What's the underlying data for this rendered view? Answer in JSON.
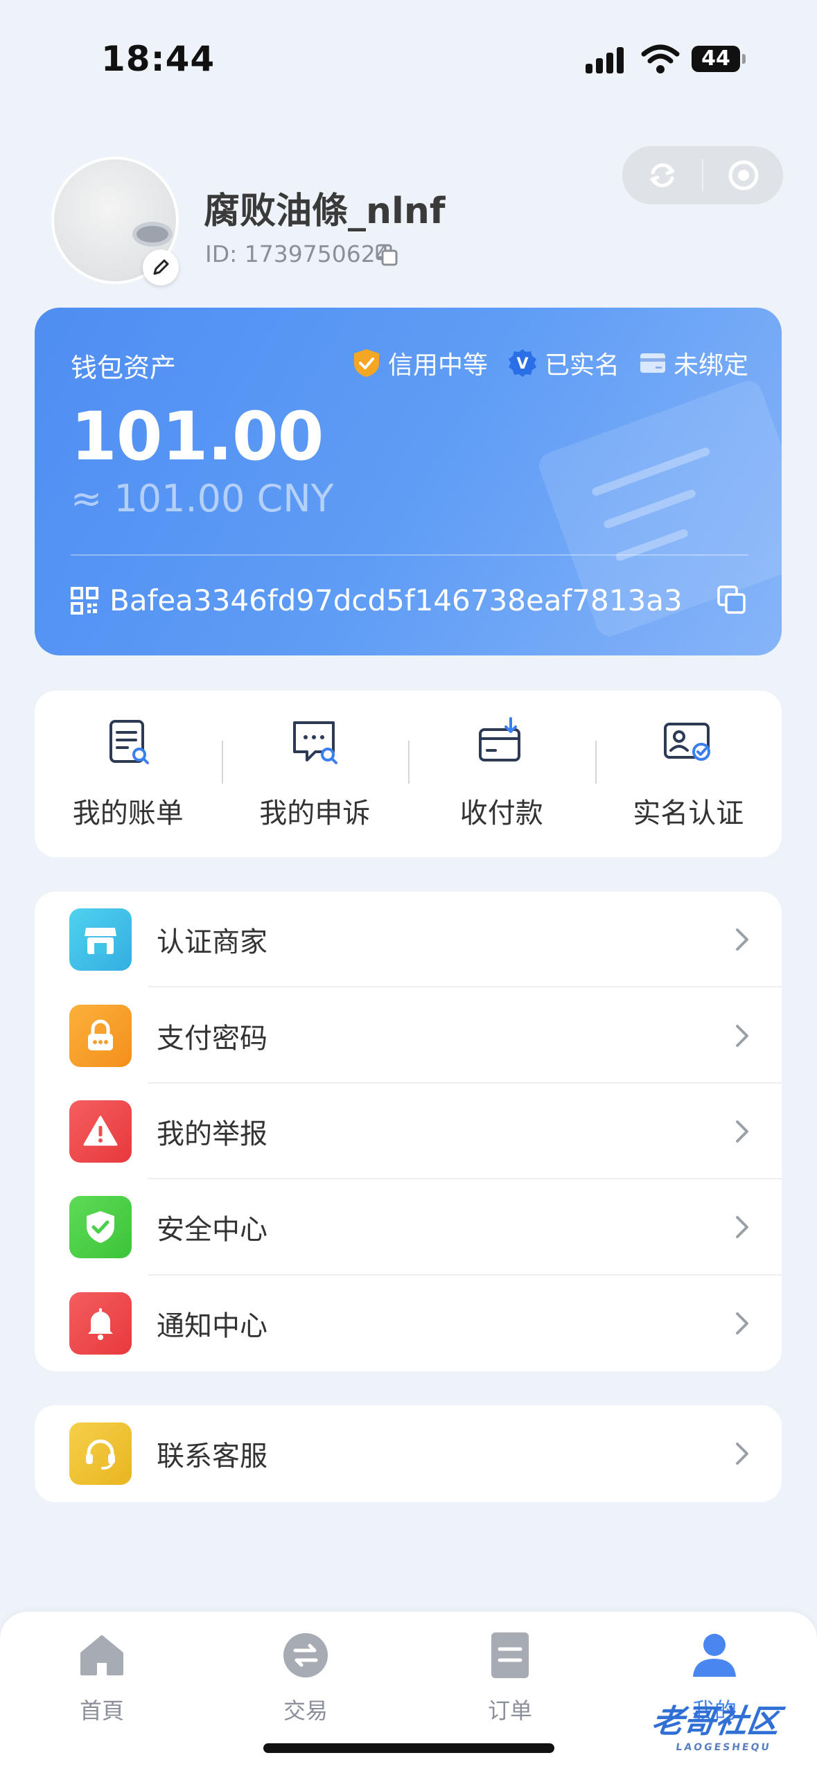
{
  "status_bar": {
    "time": "18:44",
    "battery": "44"
  },
  "profile": {
    "username": "腐败油條_nlnf",
    "id_text": "ID: 1739750624"
  },
  "wallet": {
    "label": "钱包资产",
    "badges": [
      "信用中等",
      "已实名",
      "未绑定"
    ],
    "amount": "101.00",
    "cny": "≈ 101.00 CNY",
    "address": "Bafea3346fd97dcd5f146738eaf7813a3"
  },
  "actions": [
    {
      "label": "我的账单",
      "icon": "bill-icon"
    },
    {
      "label": "我的申诉",
      "icon": "appeal-icon"
    },
    {
      "label": "收付款",
      "icon": "receive-pay-icon"
    },
    {
      "label": "实名认证",
      "icon": "id-verify-icon"
    }
  ],
  "menu": [
    {
      "label": "认证商家",
      "icon": "store-icon",
      "color": "#3fc3e6"
    },
    {
      "label": "支付密码",
      "icon": "lock-icon",
      "color": "#f7a027"
    },
    {
      "label": "我的举报",
      "icon": "warning-icon",
      "color": "#ef4e50"
    },
    {
      "label": "安全中心",
      "icon": "shield-icon",
      "color": "#4ccf4a"
    },
    {
      "label": "通知中心",
      "icon": "bell-icon",
      "color": "#ef4e50"
    }
  ],
  "support": {
    "label": "联系客服",
    "icon": "headset-icon",
    "color": "#f0c230"
  },
  "tabs": [
    {
      "label": "首頁",
      "icon": "home-icon"
    },
    {
      "label": "交易",
      "icon": "exchange-icon"
    },
    {
      "label": "订单",
      "icon": "order-icon"
    },
    {
      "label": "我的",
      "icon": "user-icon",
      "active": true
    }
  ],
  "watermark": {
    "main": "老哥社区",
    "sub": "LAOGESHEQU"
  }
}
